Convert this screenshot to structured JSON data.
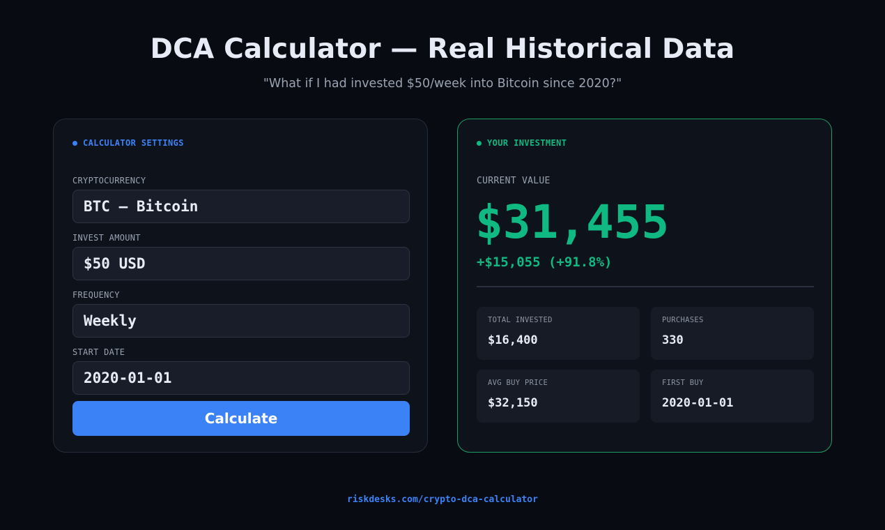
{
  "header": {
    "title": "DCA Calculator — Real Historical Data",
    "subtitle": "\"What if I had invested $50/week into Bitcoin since 2020?\""
  },
  "settings": {
    "heading": "CALCULATOR SETTINGS",
    "fields": [
      {
        "label": "CRYPTOCURRENCY",
        "value": "BTC — Bitcoin"
      },
      {
        "label": "INVEST AMOUNT",
        "value": "$50 USD"
      },
      {
        "label": "FREQUENCY",
        "value": "Weekly"
      },
      {
        "label": "START DATE",
        "value": "2020-01-01"
      }
    ],
    "button_label": "Calculate"
  },
  "investment": {
    "heading": "YOUR INVESTMENT",
    "current_value_label": "CURRENT VALUE",
    "current_value": "$31,455",
    "change": "+$15,055 (+91.8%)",
    "stats": [
      {
        "label": "TOTAL INVESTED",
        "value": "$16,400"
      },
      {
        "label": "PURCHASES",
        "value": "330"
      },
      {
        "label": "AVG BUY PRICE",
        "value": "$32,150"
      },
      {
        "label": "FIRST BUY",
        "value": "2020-01-01"
      }
    ]
  },
  "footer": {
    "link": "riskdesks.com/crypto-dca-calculator"
  },
  "colors": {
    "background": "#080b11",
    "accent_blue": "#3b82f6",
    "accent_green": "#10b981"
  }
}
